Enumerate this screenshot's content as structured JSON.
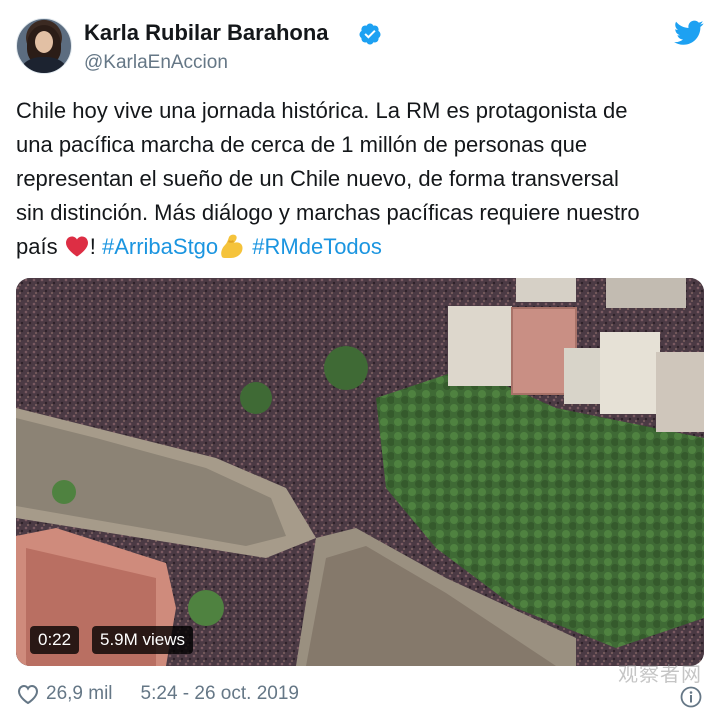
{
  "author": {
    "display_name": "Karla Rubilar Barahona",
    "handle": "@KarlaEnAccion",
    "verified": true
  },
  "tweet": {
    "lines": [
      "Chile hoy vive una jornada histórica. La RM es protagonista de",
      "una pacífica marcha de cerca de 1 millón de personas que",
      "representan el sueño de un Chile nuevo, de forma transversal",
      "sin distinción. Más diálogo y marchas pacíficas requiere nuestro"
    ],
    "last_line_prefix": "país",
    "exclamation": "!",
    "hashtag_1": "#ArribaStgo",
    "hashtag_2": "#RMdeTodos",
    "emojis": [
      "red-heart",
      "flexed-biceps"
    ]
  },
  "video": {
    "duration": "0:22",
    "views": "5.9M views"
  },
  "footer": {
    "likes": "26,9 mil",
    "timestamp": "5:24 - 26 oct. 2019"
  },
  "watermark": "观察者网",
  "colors": {
    "text": "#14171a",
    "secondary": "#657786",
    "link": "#1b95e0",
    "verified": "#1da1f2",
    "twitter_blue": "#1da1f2"
  },
  "icons": [
    "avatar",
    "verified-badge-icon",
    "twitter-bird-icon",
    "heart-outline-icon",
    "info-icon"
  ]
}
